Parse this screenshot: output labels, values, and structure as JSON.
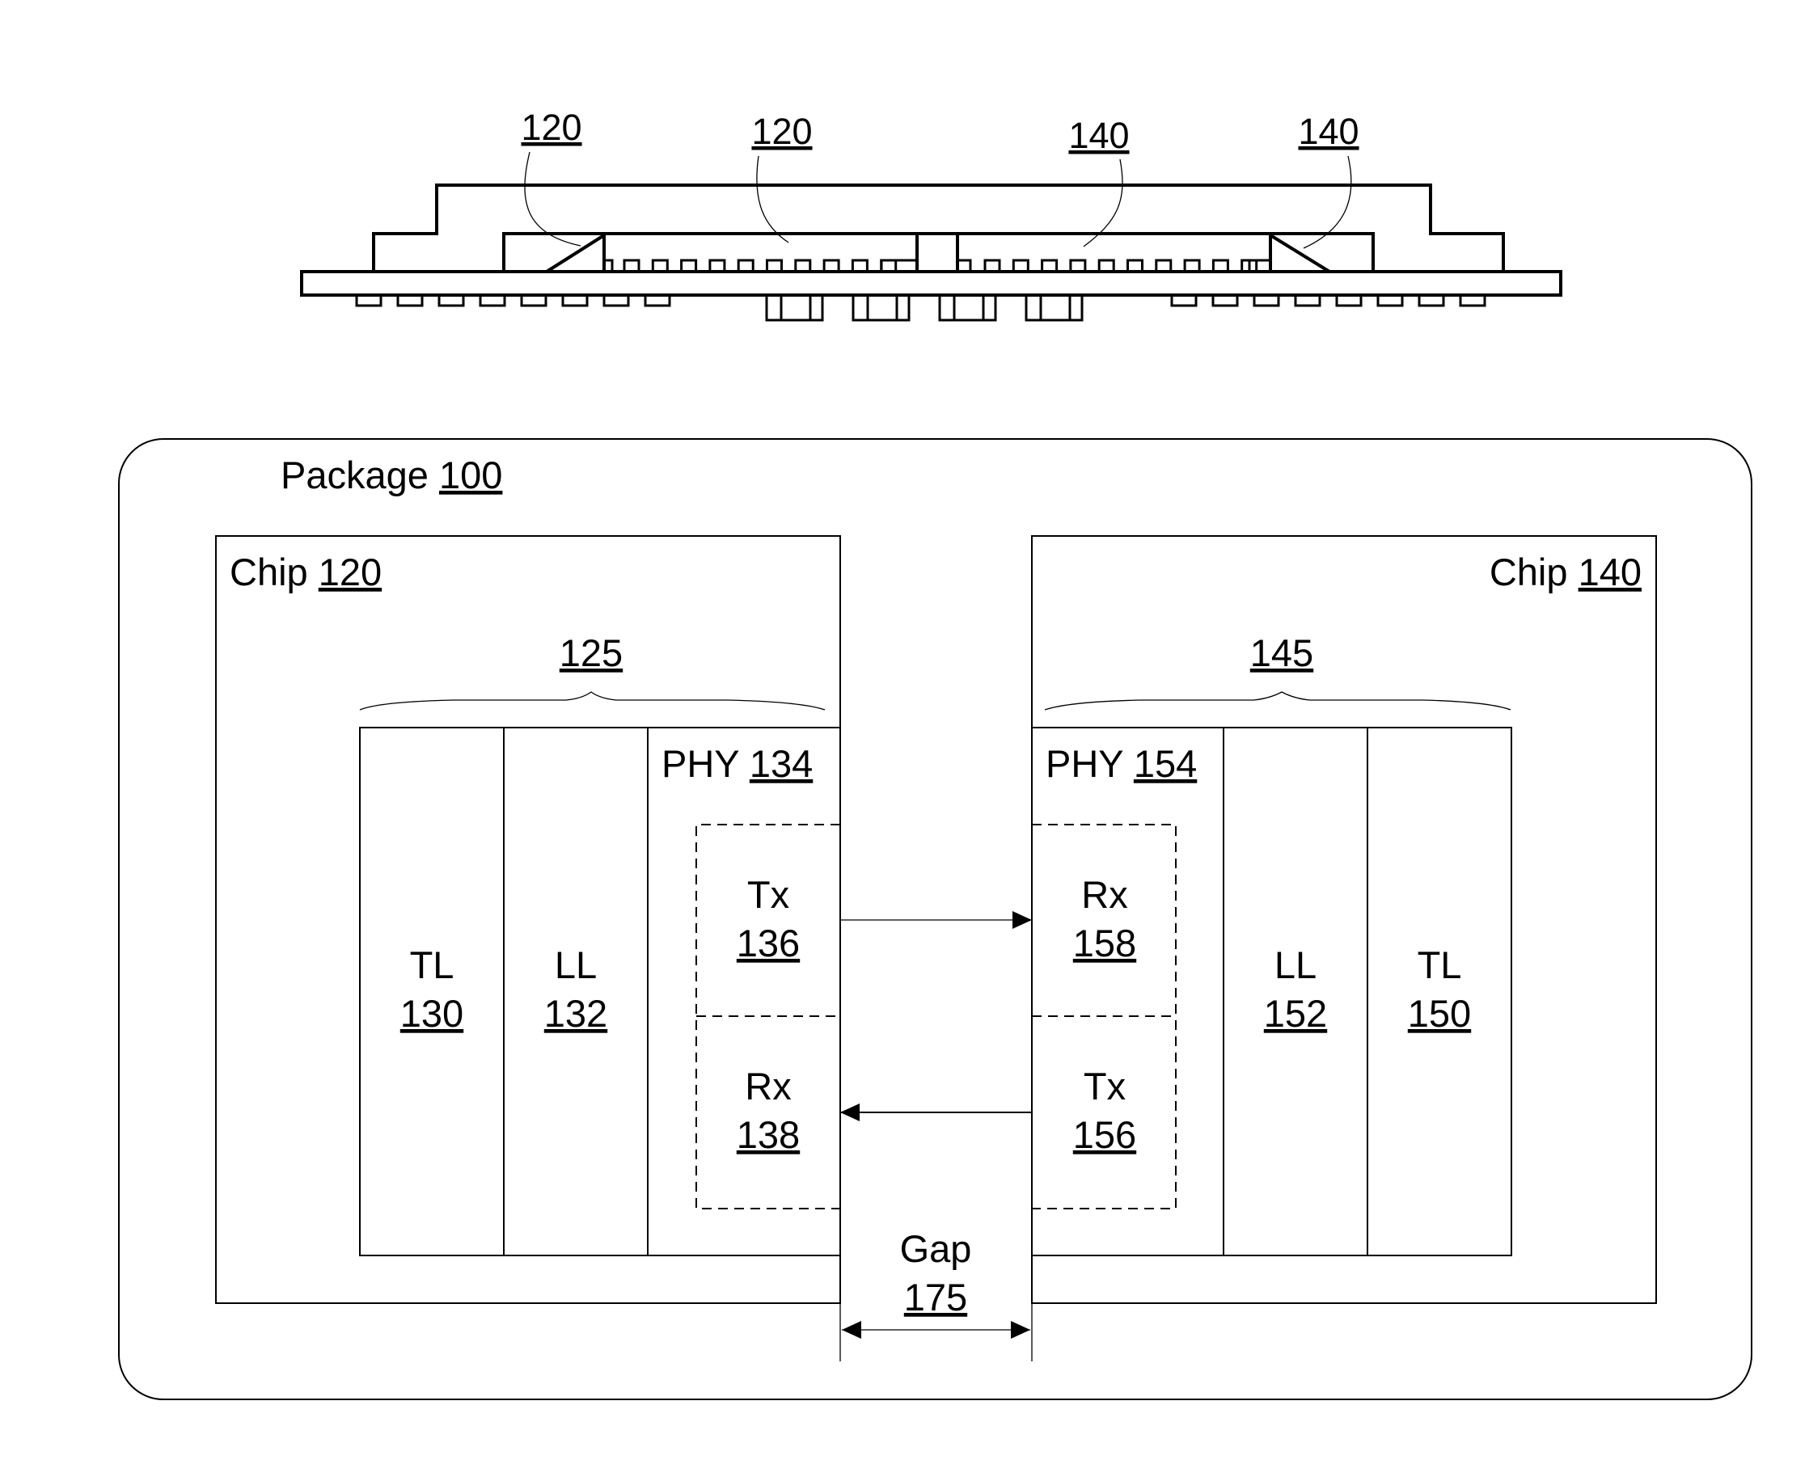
{
  "cross_section": {
    "labels": [
      {
        "ref": "120",
        "target": "chip-120-edge-coupler"
      },
      {
        "ref": "120",
        "target": "chip-120-body"
      },
      {
        "ref": "140",
        "target": "chip-140-body"
      },
      {
        "ref": "140",
        "target": "chip-140-edge-coupler"
      }
    ]
  },
  "package": {
    "label": "Package",
    "ref": "100"
  },
  "chip_left": {
    "label": "Chip",
    "ref": "120",
    "stack_ref": "125",
    "layers": [
      {
        "name": "TL",
        "ref": "130"
      },
      {
        "name": "LL",
        "ref": "132"
      },
      {
        "name": "PHY",
        "ref": "134"
      }
    ],
    "phy_blocks": [
      {
        "name": "Tx",
        "ref": "136"
      },
      {
        "name": "Rx",
        "ref": "138"
      }
    ]
  },
  "chip_right": {
    "label": "Chip",
    "ref": "140",
    "stack_ref": "145",
    "layers": [
      {
        "name": "PHY",
        "ref": "154"
      },
      {
        "name": "LL",
        "ref": "152"
      },
      {
        "name": "TL",
        "ref": "150"
      }
    ],
    "phy_blocks": [
      {
        "name": "Rx",
        "ref": "158"
      },
      {
        "name": "Tx",
        "ref": "156"
      }
    ]
  },
  "gap": {
    "label": "Gap",
    "ref": "175"
  },
  "links": [
    {
      "from": "Tx 136",
      "to": "Rx 158",
      "direction": "left-to-right"
    },
    {
      "from": "Tx 156",
      "to": "Rx 138",
      "direction": "right-to-left"
    }
  ]
}
